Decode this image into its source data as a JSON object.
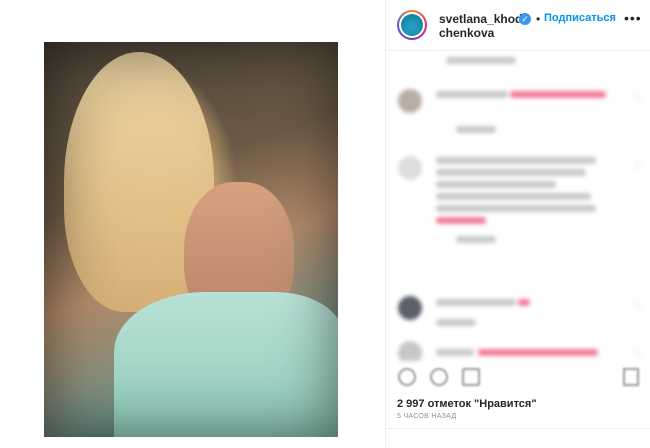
{
  "post": {
    "author": {
      "username": "svetlana_khodchenkova",
      "verified": true,
      "follow_label": "Подписаться",
      "separator": "•"
    },
    "more_label": "•••",
    "likes_text": "2 997 отметок \"Нравится\"",
    "time_text": "5 ЧАСОВ НАЗАД"
  },
  "icons": {
    "verified": "verified-badge-icon",
    "more": "more-options-icon",
    "like": "heart-icon",
    "comment": "comment-icon",
    "share": "share-icon",
    "save": "bookmark-icon"
  },
  "colors": {
    "follow": "#0095f6",
    "verified": "#3897f0",
    "text": "#262626",
    "muted": "#8e8e8e"
  }
}
